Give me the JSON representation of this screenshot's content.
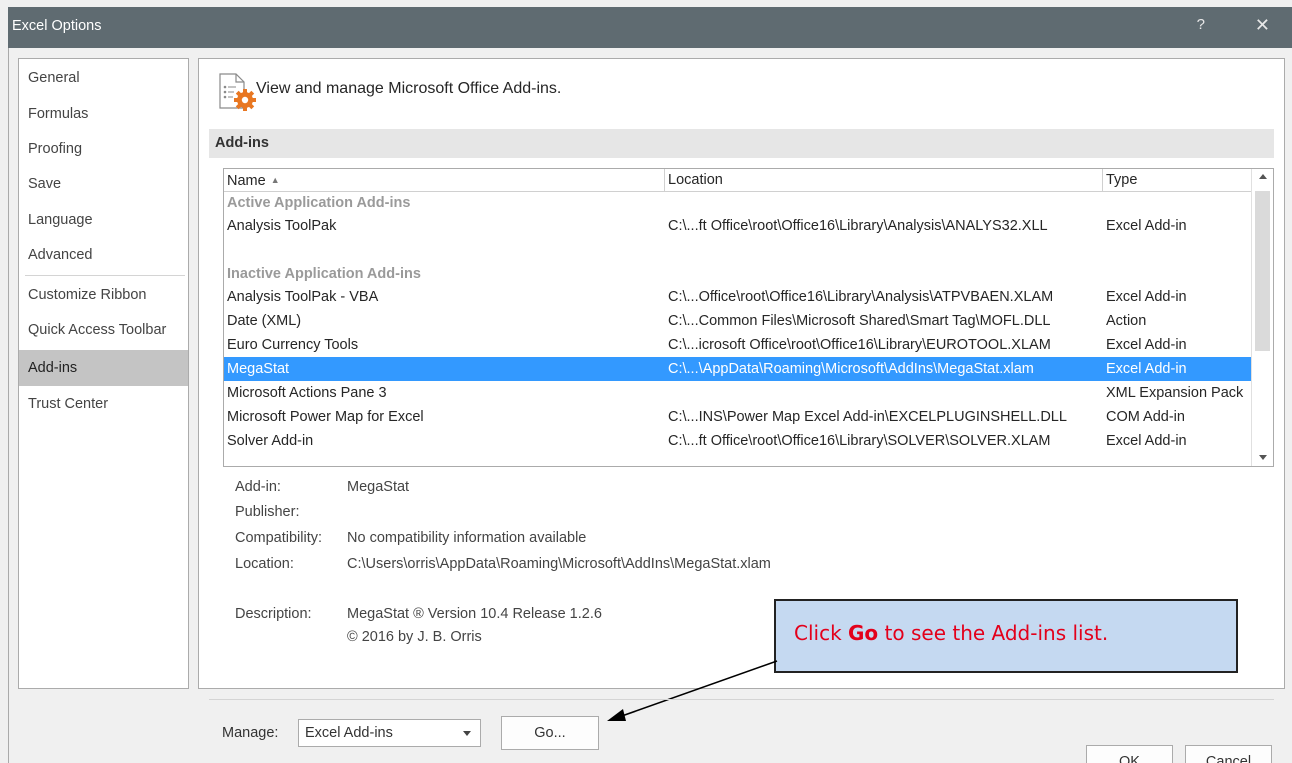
{
  "window": {
    "title": "Excel Options",
    "help_label": "?",
    "close_label": "✕"
  },
  "sidebar": {
    "items": [
      {
        "label": "General"
      },
      {
        "label": "Formulas"
      },
      {
        "label": "Proofing"
      },
      {
        "label": "Save"
      },
      {
        "label": "Language"
      },
      {
        "label": "Advanced"
      },
      {
        "label": "Customize Ribbon"
      },
      {
        "label": "Quick Access Toolbar"
      },
      {
        "label": "Add-ins",
        "selected": true
      },
      {
        "label": "Trust Center"
      }
    ]
  },
  "main": {
    "header_text": "View and manage Microsoft Office Add-ins.",
    "section_title": "Add-ins",
    "columns": {
      "name": "Name",
      "location": "Location",
      "type": "Type",
      "sort_indicator": "▲"
    },
    "groups": {
      "active": "Active Application Add-ins",
      "inactive": "Inactive Application Add-ins"
    },
    "rows": [
      {
        "name": "Analysis ToolPak",
        "location": "C:\\...ft Office\\root\\Office16\\Library\\Analysis\\ANALYS32.XLL",
        "type": "Excel Add-in"
      },
      {
        "name": "Analysis ToolPak - VBA",
        "location": "C:\\...Office\\root\\Office16\\Library\\Analysis\\ATPVBAEN.XLAM",
        "type": "Excel Add-in"
      },
      {
        "name": "Date (XML)",
        "location": "C:\\...Common Files\\Microsoft Shared\\Smart Tag\\MOFL.DLL",
        "type": "Action"
      },
      {
        "name": "Euro Currency Tools",
        "location": "C:\\...icrosoft Office\\root\\Office16\\Library\\EUROTOOL.XLAM",
        "type": "Excel Add-in"
      },
      {
        "name": "MegaStat",
        "location": "C:\\...\\AppData\\Roaming\\Microsoft\\AddIns\\MegaStat.xlam",
        "type": "Excel Add-in",
        "selected": true
      },
      {
        "name": "Microsoft Actions Pane 3",
        "location": "",
        "type": "XML Expansion Pack"
      },
      {
        "name": "Microsoft Power Map for Excel",
        "location": "C:\\...INS\\Power Map Excel Add-in\\EXCELPLUGINSHELL.DLL",
        "type": "COM Add-in"
      },
      {
        "name": "Solver Add-in",
        "location": "C:\\...ft Office\\root\\Office16\\Library\\SOLVER\\SOLVER.XLAM",
        "type": "Excel Add-in"
      }
    ],
    "details": {
      "addin_label": "Add-in:",
      "addin_value": "MegaStat",
      "publisher_label": "Publisher:",
      "publisher_value": "",
      "compat_label": "Compatibility:",
      "compat_value": "No compatibility information available",
      "location_label": "Location:",
      "location_value": "C:\\Users\\orris\\AppData\\Roaming\\Microsoft\\AddIns\\MegaStat.xlam",
      "description_label": "Description:",
      "description_line1": "MegaStat ® Version 10.4 Release 1.2.6",
      "description_line2": "© 2016 by J. B. Orris"
    },
    "callout": {
      "prefix": "Click ",
      "bold": "Go",
      "suffix": " to see the Add-ins list."
    },
    "manage": {
      "label": "Manage:",
      "selected": "Excel Add-ins",
      "go_label": "Go..."
    }
  },
  "footer": {
    "ok_label": "OK",
    "cancel_label": "Cancel"
  },
  "colors": {
    "titlebar": "#5f6b71",
    "selection": "#3399ff",
    "callout_bg": "#c5d9f1",
    "callout_text": "#e3001b"
  }
}
